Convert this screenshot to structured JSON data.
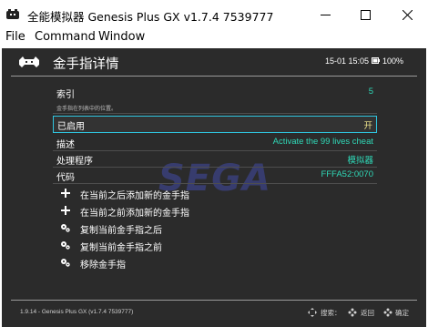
{
  "window": {
    "title": "全能模拟器 Genesis Plus GX v1.7.4 7539777",
    "minimize_glyph": "—",
    "close_glyph": "✕"
  },
  "menu": {
    "items": [
      "File",
      "Command",
      "Window"
    ]
  },
  "header": {
    "title": "金手指详情",
    "clock": "15-01 15:05",
    "battery": "100%"
  },
  "rows": [
    {
      "label": "索引",
      "value": "5",
      "sublabel": "金手指在列表中的位置。"
    },
    {
      "label": "已启用",
      "value": "开"
    },
    {
      "label": "描述",
      "value": "Activate the 99 lives cheat"
    },
    {
      "label": "处理程序",
      "value": "模拟器"
    },
    {
      "label": "代码",
      "value": "FFFA52:0070"
    }
  ],
  "actions": [
    {
      "label": "在当前之后添加新的金手指",
      "icon": "plus-icon"
    },
    {
      "label": "在当前之前添加新的金手指",
      "icon": "plus-icon"
    },
    {
      "label": "复制当前金手指之后",
      "icon": "gears-icon"
    },
    {
      "label": "复制当前金手指之前",
      "icon": "gears-icon"
    },
    {
      "label": "移除金手指",
      "icon": "gears-icon"
    }
  ],
  "background_logo": "SEGA",
  "footer": {
    "version": "1.9.14 - Genesis Plus GX (v1.7.4 7539777)",
    "hints": [
      "搜索：",
      "返回",
      "确定"
    ]
  },
  "colors": {
    "accent": "#2fd9b8",
    "selection_border": "#2fc6e0",
    "background": "#2b2b2b"
  }
}
